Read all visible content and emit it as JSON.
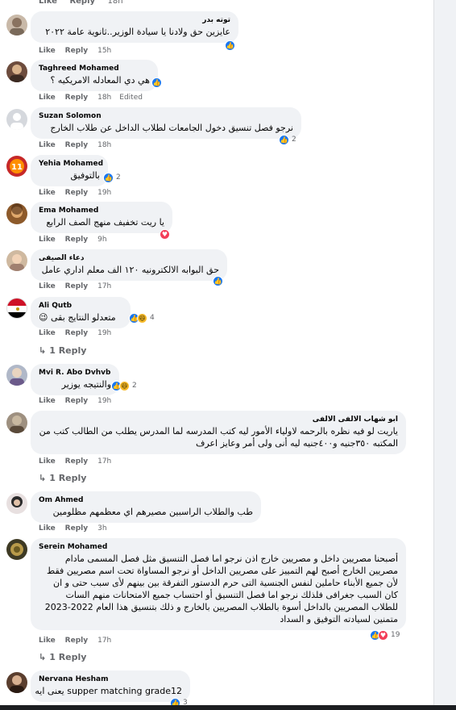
{
  "common": {
    "like": "Like",
    "reply": "Reply",
    "edited": "Edited",
    "reply_link": "1 Reply",
    "reply_arrow": "↳"
  },
  "top_row": {
    "time": "18h"
  },
  "comments": [
    {
      "name": "توته بدر",
      "text": "عايزين حق ولادنا يا سيادة الوزير..ثانوية عامة ٢٠٢٢",
      "time": "15h",
      "reactions": [
        "like"
      ],
      "count": ""
    },
    {
      "name": "Taghreed Mohamed",
      "text": "هي دي المعادله الامريكيه ؟",
      "time": "18h",
      "reactions": [
        "like"
      ],
      "count": ""
    },
    {
      "name": "Suzan Solomon",
      "text": "نرجو فصل تنسيق دخول الجامعات لطلاب الداخل عن طلاب الخارج",
      "time": "18h",
      "reactions": [
        "like"
      ],
      "count": "2"
    },
    {
      "name": "Yehia Mohamed",
      "text": "بالتوفيق",
      "time": "19h",
      "reactions": [
        "like"
      ],
      "count": "2"
    },
    {
      "name": "Ema Mohamed",
      "text": "يا ريت تخفيف منهج الصف الرابع",
      "time": "9h",
      "reactions": [
        "love"
      ],
      "count": ""
    },
    {
      "name": "دعاء الصيفى",
      "text": "حق البوابه الالكترونيه ١٢٠ الف معلم اداري عامل",
      "time": "17h",
      "reactions": [
        "like"
      ],
      "count": ""
    },
    {
      "name": "Ali Qutb",
      "text": "متعدلو النتايج بقى 😉",
      "time": "19h",
      "reactions": [
        "like",
        "haha"
      ],
      "count": "4"
    },
    {
      "name": "Mvi R. Abo Dvhvb",
      "text": "والنتيجه يوزير",
      "time": "19h",
      "reactions": [
        "like",
        "haha"
      ],
      "count": "2"
    },
    {
      "name": "ابو شهاب الالفى الالفى",
      "text": "ياريت لو فيه نظره بالرحمه لاولياء الأمور ليه كتب المدرسه لما المدرس يطلب من الطالب كتب من المكتبه ٣٥٠جنيه و٤٠٠جنيه ليه أنى ولى أمر وعايز اعرف",
      "time": "17h",
      "reactions": [],
      "count": ""
    },
    {
      "name": "Om Ahmed",
      "text": "طب والطلاب الراسبين مصيرهم اي معظمهم مظلومين",
      "time": "3h",
      "reactions": [],
      "count": ""
    },
    {
      "name": "Serein Mohamed",
      "text": "أصبحنا مصريين داخل و مصريين خارج اذن نرجو اما فصل التنسيق مثل فصل المسمى مادام مصريين الخارج أصبح لهم التمييز على مصريين الداخل أو نرجو المساواة تحت اسم مصريين فقط لأن جميع الأبناء حاملين لنفس الجنسية التى حرم الدستور التفرقة بين بينهم لأى سبب حتى و ان كان السبب جغرافى فلذلك نرجو اما فصل التنسيق أو احتساب جميع الامتحانات منهم السات للطلاب المصريين بالداخل أسوة بالطلاب المصريين بالخارج و ذلك بتنسيق هذا العام 2022-2023 متمنين لسيادته التوفيق و السداد",
      "time": "17h",
      "reactions": [
        "like",
        "love"
      ],
      "count": "19"
    },
    {
      "name": "Nervana Hesham",
      "text": "supper matching grade12 يعنى ايه",
      "time": "",
      "reactions": [
        "like"
      ],
      "count": "3"
    }
  ]
}
